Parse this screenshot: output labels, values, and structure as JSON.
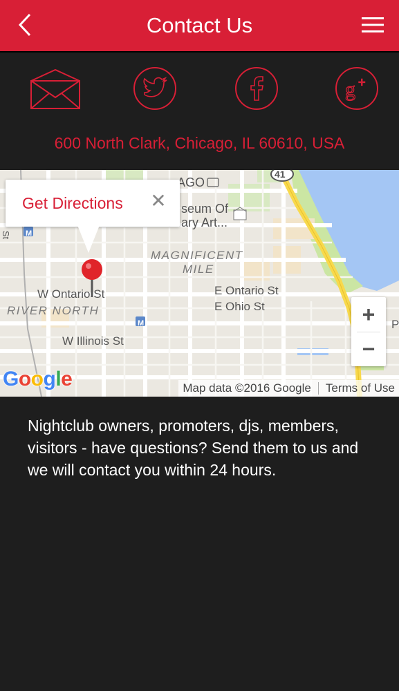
{
  "header": {
    "title": "Contact Us",
    "back_icon": "chevron-left-icon",
    "menu_icon": "hamburger-menu-icon",
    "background": "#d81f36"
  },
  "social": [
    {
      "name": "email",
      "icon": "envelope-icon"
    },
    {
      "name": "twitter",
      "icon": "twitter-icon"
    },
    {
      "name": "facebook",
      "icon": "facebook-icon"
    },
    {
      "name": "google-plus",
      "icon": "google-plus-icon"
    }
  ],
  "address": "600 North Clark, Chicago, IL 60610, USA",
  "map": {
    "popup_label": "Get Directions",
    "popup_close": "✕",
    "labels": {
      "chicago": "AGO",
      "museum_line1": "seum Of",
      "museum_line2": "ary Art...",
      "magnificent": "MAGNIFICENT",
      "mile": "MILE",
      "w_ontario": "W Ontario St",
      "river_north": "RIVER NORTH",
      "e_ontario": "E Ontario St",
      "e_ohio": "E Ohio St",
      "w_illinois": "W Illinois St",
      "route": "41",
      "metro": "M",
      "edge_st": "St",
      "edge_p": "P"
    },
    "zoom_in": "+",
    "zoom_out": "−",
    "google_logo": [
      "G",
      "o",
      "o",
      "g",
      "l",
      "e"
    ],
    "map_data": "Map data ©2016 Google",
    "terms": "Terms of Use"
  },
  "body_text": "Nightclub owners, promoters, djs, members, visitors - have questions? Send them to us and we will contact you within 24 hours.",
  "colors": {
    "accent": "#d81f36",
    "background": "#1e1e1e",
    "text": "#ffffff"
  }
}
